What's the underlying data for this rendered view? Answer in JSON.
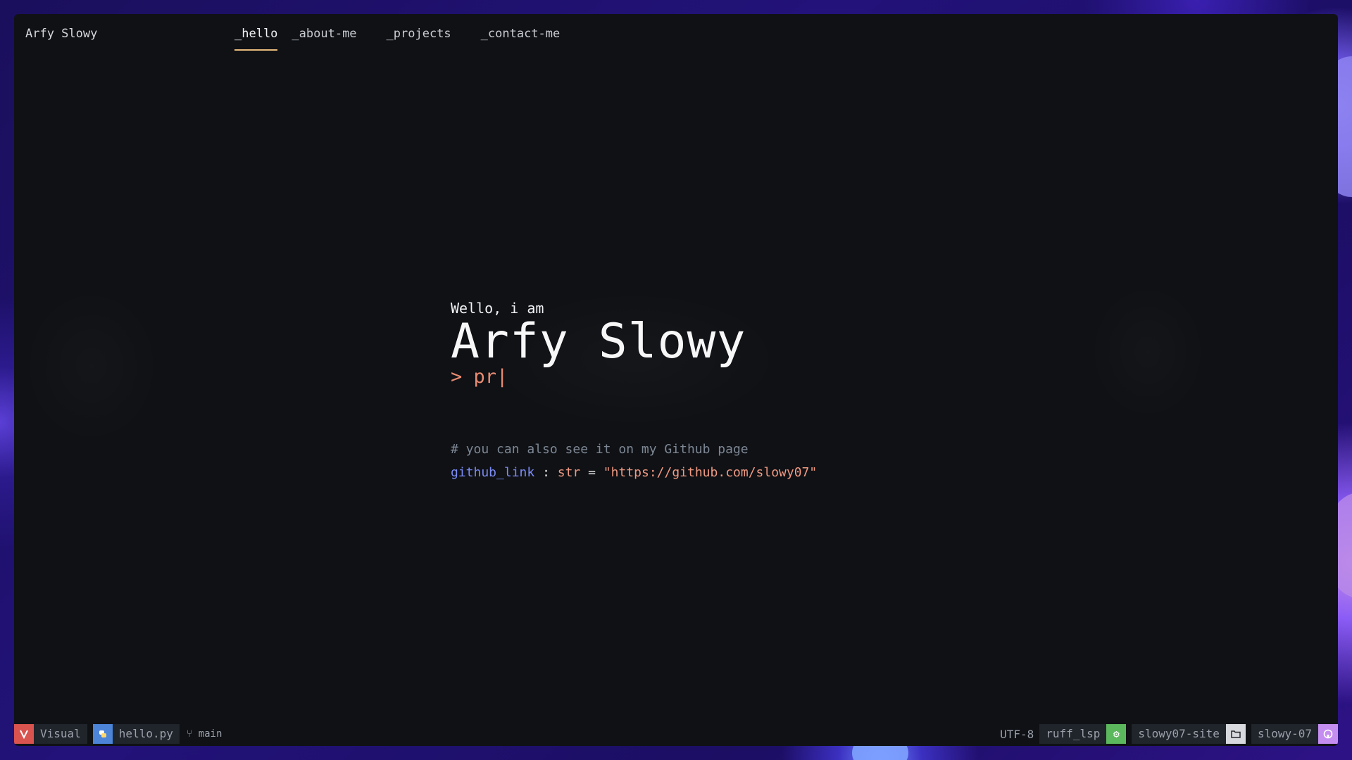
{
  "window": {
    "brand": "Arfy Slowy"
  },
  "nav": {
    "items": [
      {
        "label": "_hello",
        "active": true
      },
      {
        "label": "_about-me",
        "active": false
      },
      {
        "label": "_projects",
        "active": false
      },
      {
        "label": "_contact-me",
        "active": false
      }
    ]
  },
  "hero": {
    "greeting": "Wello, i am",
    "name": "Arfy Slowy",
    "prompt_symbol": ">",
    "typed_text": "pr",
    "caret": "|"
  },
  "code": {
    "comment": "# you can also see it on my Github page",
    "var_name": "github_link",
    "colon": ":",
    "type": "str",
    "equals": "=",
    "value": "\"https://github.com/slowy07\""
  },
  "statusbar": {
    "mode": "Visual",
    "file": "hello.py",
    "branch": "main",
    "encoding": "UTF-8",
    "lsp": "ruff_lsp",
    "project": "slowy07-site",
    "user": "slowy-07",
    "icons": {
      "mode": "vim-icon",
      "file": "python-icon",
      "branch": "git-branch-icon",
      "lsp": "gear-icon",
      "project": "folder-icon",
      "user": "github-icon"
    }
  },
  "colors": {
    "accent": "#e7b97a",
    "prompt": "#e98b72",
    "variable": "#7c8cf5",
    "comment": "#7d8794",
    "background": "#0f1115"
  }
}
